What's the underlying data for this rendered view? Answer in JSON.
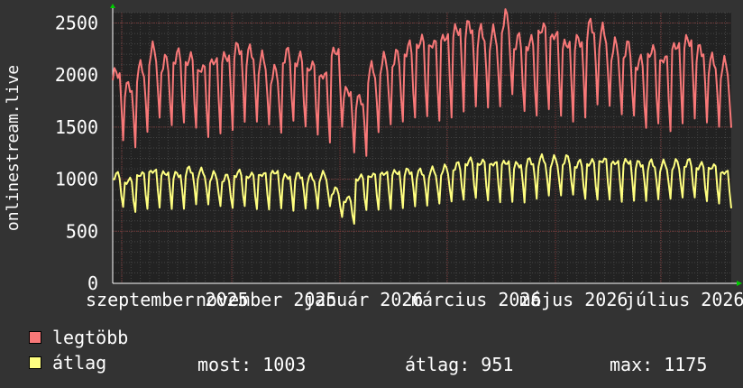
{
  "chart_data": {
    "type": "line",
    "ylabel": "onlinestream.live",
    "ylim": [
      0,
      2600
    ],
    "yticks": [
      0,
      500,
      1000,
      1500,
      2000,
      2500
    ],
    "x_tick_labels": [
      "szeptember 2025",
      "november 2025",
      "január 2026",
      "március 2026",
      "május 2026",
      "július 2026"
    ],
    "grid": true,
    "series": [
      {
        "name": "legtöbb",
        "color": "#f87878",
        "weekly_values": [
          1950,
          1820,
          1990,
          2150,
          2050,
          2110,
          2080,
          1990,
          2060,
          2100,
          2180,
          2140,
          2070,
          1950,
          2120,
          2080,
          2010,
          1930,
          2150,
          1780,
          1700,
          1980,
          2060,
          2100,
          2180,
          2240,
          2220,
          2280,
          2350,
          2380,
          2320,
          2300,
          2450,
          2250,
          2230,
          2360,
          2300,
          2220,
          2250,
          2380,
          2320,
          2190,
          2180,
          2050,
          2150,
          2080,
          2200,
          2250,
          2160,
          2060,
          2020
        ]
      },
      {
        "name": "átlag",
        "color": "#ffff80",
        "weekly_values": [
          1000,
          950,
          1010,
          1040,
          1020,
          1010,
          1050,
          1030,
          1000,
          980,
          1020,
          1000,
          1010,
          1030,
          990,
          1000,
          980,
          1000,
          860,
          780,
          980,
          1000,
          1020,
          1030,
          1040,
          1030,
          1040,
          1060,
          1090,
          1130,
          1120,
          1110,
          1120,
          1100,
          1130,
          1150,
          1140,
          1150,
          1110,
          1120,
          1140,
          1120,
          1130,
          1110,
          1110,
          1100,
          1110,
          1120,
          1090,
          1080,
          1030
        ]
      }
    ]
  },
  "legend": [
    {
      "label": "legtöbb",
      "color": "#f87878"
    },
    {
      "label": "átlag",
      "color": "#ffff80"
    }
  ],
  "stats": {
    "current": "most: 1003",
    "average": "átlag: 951",
    "max": "max: 1175"
  }
}
